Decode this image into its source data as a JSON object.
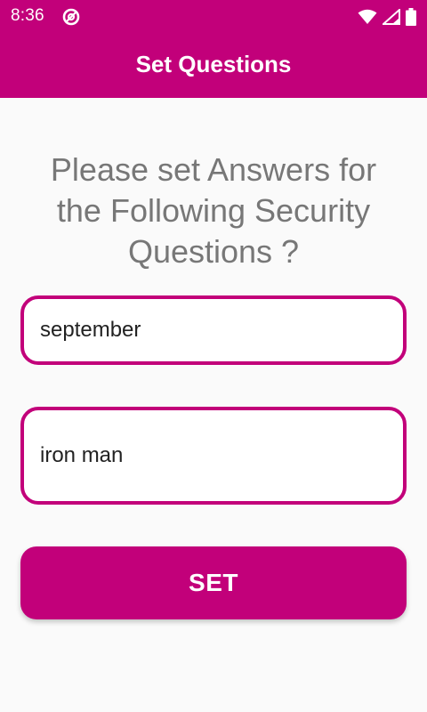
{
  "status_bar": {
    "time": "8:36",
    "app_icon": "at-sign-icon",
    "icons": [
      "wifi-icon",
      "signal-icon",
      "battery-icon"
    ]
  },
  "app_bar": {
    "title": "Set Questions"
  },
  "prompt": {
    "line1": "Please set Answers for",
    "line2": "the Following Security",
    "line3": "Questions ?"
  },
  "answers": {
    "answer1_value": "september",
    "answer2_value": "iron man"
  },
  "set_button": {
    "label": "SET"
  },
  "colors": {
    "accent": "#c2007a",
    "background": "#fafafa",
    "prompt_text": "#777777"
  }
}
